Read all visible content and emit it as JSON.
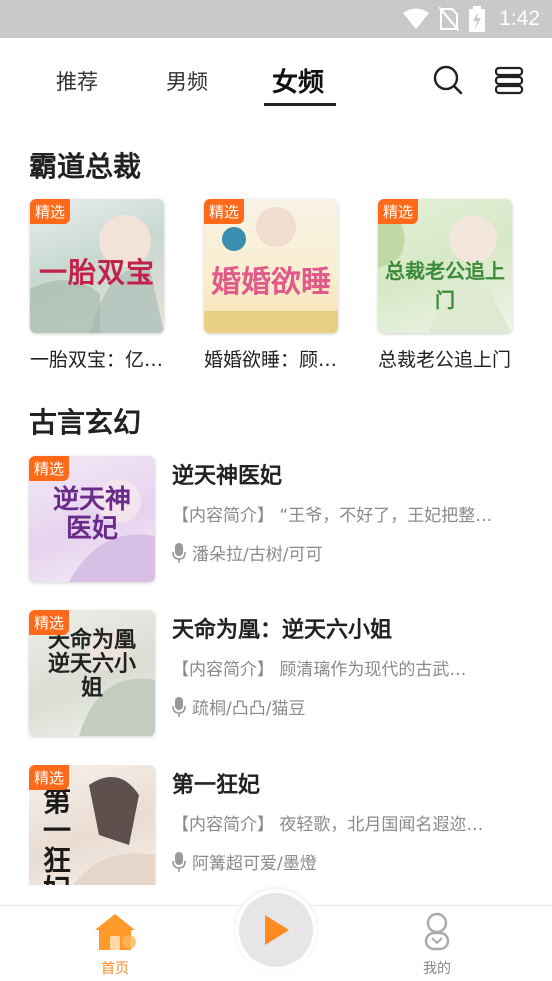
{
  "status_bar": {
    "time": "1:42"
  },
  "top_tabs": [
    {
      "label": "推荐"
    },
    {
      "label": "男频"
    },
    {
      "label": "女频"
    }
  ],
  "sections": {
    "featured": {
      "title": "霸道总裁",
      "books": [
        {
          "badge": "精选",
          "cover_text": "一胎双宝",
          "title": "一胎双宝：亿…"
        },
        {
          "badge": "精选",
          "cover_text": "婚婚欲睡",
          "title": "婚婚欲睡：顾…"
        },
        {
          "badge": "精选",
          "cover_text": "总裁老公追上门",
          "title": "总裁老公追上门"
        }
      ]
    },
    "list": {
      "title": "古言玄幻",
      "books": [
        {
          "badge": "精选",
          "cover_text": "逆天神医妃",
          "title": "逆天神医妃",
          "description": "【内容简介】 “王爷，不好了，王妃把整…",
          "voices": "潘朵拉/古树/可可"
        },
        {
          "badge": "精选",
          "cover_text": "天命为凰逆天六小姐",
          "title": "天命为凰：逆天六小姐",
          "description": "【内容简介】 顾清璃作为现代的古武…",
          "voices": "疏桐/凸凸/猫豆"
        },
        {
          "badge": "精选",
          "cover_text": "第一狂妃",
          "title": "第一狂妃",
          "description": "【内容简介】 夜轻歌，北月国闻名遐迩…",
          "voices": "阿篝超可爱/墨燈"
        }
      ]
    }
  },
  "bottom_nav": {
    "home_label": "首页",
    "mine_label": "我的"
  },
  "colors": {
    "accent": "#ff8a1f",
    "badge": "#ff6a1a",
    "status_bar": "#c9c9c9"
  }
}
